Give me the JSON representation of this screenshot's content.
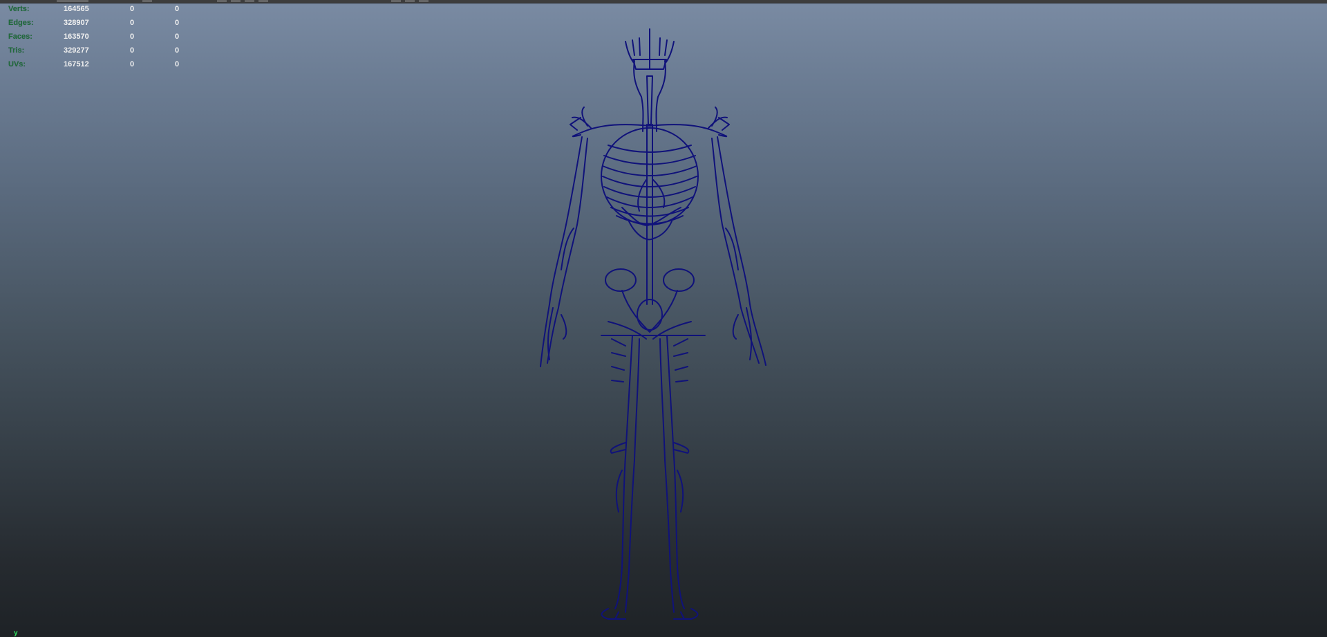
{
  "hud": {
    "rows": [
      {
        "label": "Verts:",
        "v1": "164565",
        "v2": "0",
        "v3": "0"
      },
      {
        "label": "Edges:",
        "v1": "328907",
        "v2": "0",
        "v3": "0"
      },
      {
        "label": "Faces:",
        "v1": "163570",
        "v2": "0",
        "v3": "0"
      },
      {
        "label": "Tris:",
        "v1": "329277",
        "v2": "0",
        "v3": "0"
      },
      {
        "label": "UVs:",
        "v1": "167512",
        "v2": "0",
        "v3": "0"
      }
    ]
  },
  "axis": {
    "label": "y"
  },
  "colors": {
    "wireframe": "#10127a",
    "hud_label": "#1f6b3a",
    "hud_value": "#f0f0f0",
    "axis": "#30e860"
  },
  "icons": [
    "axis-indicator-icon"
  ]
}
